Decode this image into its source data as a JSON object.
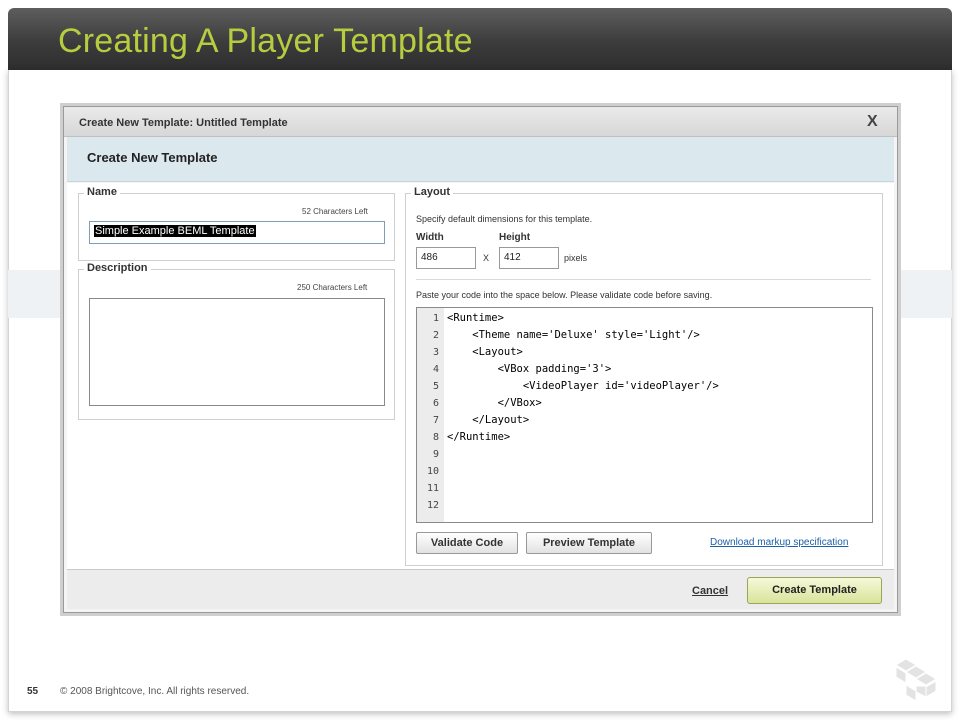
{
  "slide": {
    "title": "Creating A Player Template",
    "page_number": "55",
    "copyright": "© 2008 Brightcove, Inc. All rights reserved."
  },
  "dialog": {
    "titlebar": "Create New Template: Untitled Template",
    "close_glyph": "X",
    "heading": "Create New Template",
    "name": {
      "legend": "Name",
      "chars_left": "52 Characters Left",
      "value": "Simple Example BEML Template"
    },
    "description": {
      "legend": "Description",
      "chars_left": "250 Characters Left",
      "value": ""
    },
    "layout": {
      "legend": "Layout",
      "instructions": "Specify default dimensions for this template.",
      "width_label": "Width",
      "height_label": "Height",
      "width_value": "486",
      "separator": "X",
      "height_value": "412",
      "unit": "pixels",
      "code_instructions": "Paste your code into the space below. Please validate code before saving.",
      "line_numbers": [
        "1",
        "2",
        "3",
        "4",
        "5",
        "6",
        "7",
        "8",
        "9",
        "10",
        "11",
        "12"
      ],
      "code_lines": [
        "<Runtime>",
        "    <Theme name='Deluxe' style='Light'/>",
        "    <Layout>",
        "        <VBox padding='3'>",
        "            <VideoPlayer id='videoPlayer'/>",
        "        </VBox>",
        "    </Layout>",
        "</Runtime>",
        "",
        "",
        "",
        ""
      ],
      "validate_label": "Validate Code",
      "preview_label": "Preview Template",
      "download_link": "Download markup specification"
    },
    "footer": {
      "cancel_label": "Cancel",
      "create_label": "Create Template"
    }
  },
  "colors": {
    "title_green": "#b7cd3f",
    "header_dark": "#3c3c3c",
    "heading_band": "#dbe9ef",
    "link_blue": "#1f5fa8"
  }
}
